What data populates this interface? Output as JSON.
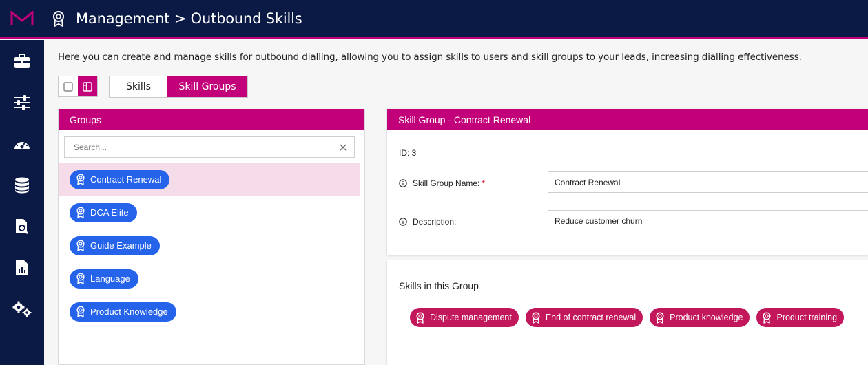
{
  "header": {
    "title": "Management > Outbound Skills"
  },
  "sidebar": {
    "items": [
      {
        "icon": "briefcase-icon"
      },
      {
        "icon": "sliders-icon"
      },
      {
        "icon": "speedometer-icon"
      },
      {
        "icon": "database-icon"
      },
      {
        "icon": "document-search-icon"
      },
      {
        "icon": "report-icon"
      },
      {
        "icon": "gears-icon"
      }
    ]
  },
  "intro_text": "Here you can create and manage skills for outbound dialling, allowing you to assign skills to users and skill groups to your leads, increasing dialling effectiveness.",
  "tabs": {
    "skills_label": "Skills",
    "groups_label": "Skill Groups",
    "active": "Skill Groups"
  },
  "groups_panel": {
    "title": "Groups",
    "search_placeholder": "Search...",
    "items": [
      {
        "label": "Contract Renewal",
        "selected": true
      },
      {
        "label": "DCA Elite"
      },
      {
        "label": "Guide Example"
      },
      {
        "label": "Language"
      },
      {
        "label": "Product Knowledge"
      }
    ]
  },
  "detail_panel": {
    "title": "Skill Group - Contract Renewal",
    "id_text": "ID: 3",
    "name_label": "Skill Group Name:",
    "name_required": "*",
    "name_value": "Contract Renewal",
    "description_label": "Description:",
    "description_value": "Reduce customer churn"
  },
  "skills_panel": {
    "title": "Skills in this Group",
    "skills": [
      {
        "label": "Dispute management"
      },
      {
        "label": "End of contract renewal"
      },
      {
        "label": "Product knowledge"
      },
      {
        "label": "Product training"
      }
    ]
  },
  "colors": {
    "navy": "#0a1a44",
    "accent": "#c2007a",
    "chip_blue": "#2563eb",
    "chip_pink": "#c2185b",
    "selected_row": "#f6dbe9"
  }
}
